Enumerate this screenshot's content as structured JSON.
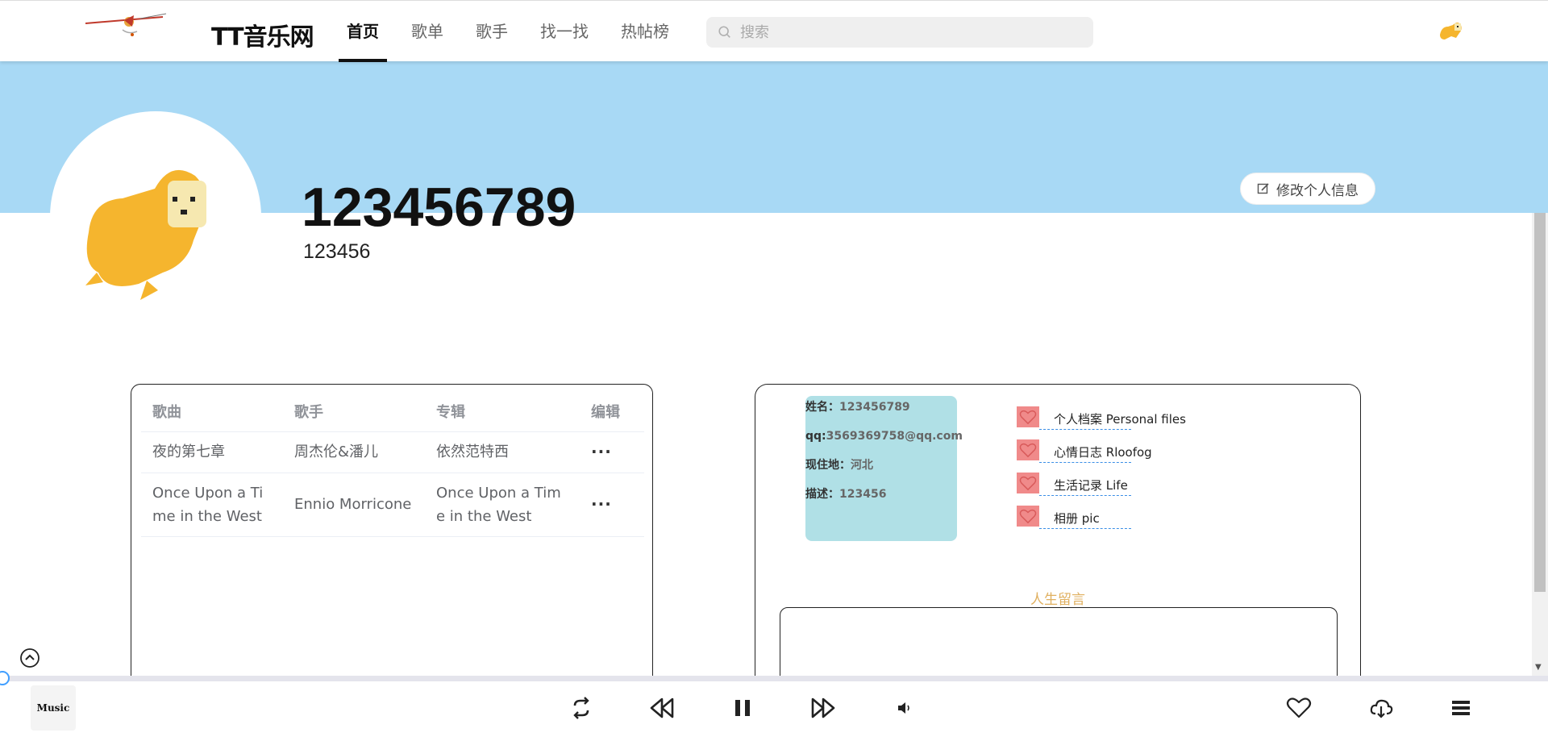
{
  "header": {
    "site_title": "TT音乐网",
    "nav": [
      {
        "label": "首页",
        "active": true
      },
      {
        "label": "歌单",
        "active": false
      },
      {
        "label": "歌手",
        "active": false
      },
      {
        "label": "找一找",
        "active": false
      },
      {
        "label": "热帖榜",
        "active": false
      }
    ],
    "search_placeholder": "搜索",
    "search_value": ""
  },
  "profile": {
    "name": "123456789",
    "subtitle": "123456",
    "edit_button": "修改个人信息",
    "banner_color": "#a8d9f5"
  },
  "songs": {
    "headers": [
      "歌曲",
      "歌手",
      "专辑",
      "编辑"
    ],
    "rows": [
      {
        "song": "夜的第七章",
        "singer": "周杰伦&潘儿",
        "album": "依然范特西",
        "edit": "···"
      },
      {
        "song": "Once Upon a Time in the West",
        "singer": "Ennio Morricone",
        "album": "Once Upon a Time in the West",
        "edit": "···"
      }
    ]
  },
  "info": {
    "rows": [
      {
        "label": "姓名：",
        "value": "123456789"
      },
      {
        "label": "qq:",
        "value": "3569369758@qq.com"
      },
      {
        "label": "现住地：",
        "value": "河北"
      },
      {
        "label": "描述：",
        "value": "123456"
      }
    ],
    "box_color": "#b0e0e6",
    "links": [
      {
        "label": "个人档案 Personal files",
        "icon": "heart-icon"
      },
      {
        "label": "心情日志 Rloofog",
        "icon": "heart-icon"
      },
      {
        "label": "生活记录 Life",
        "icon": "heart-icon"
      },
      {
        "label": "相册 pic",
        "icon": "heart-icon"
      }
    ],
    "message_title": "人生留言"
  },
  "player": {
    "album_label": "Music",
    "progress": 0,
    "controls": [
      "loop-icon",
      "previous-icon",
      "pause-icon",
      "next-icon",
      "volume-icon",
      "like-icon",
      "download-icon",
      "playlist-icon"
    ]
  }
}
